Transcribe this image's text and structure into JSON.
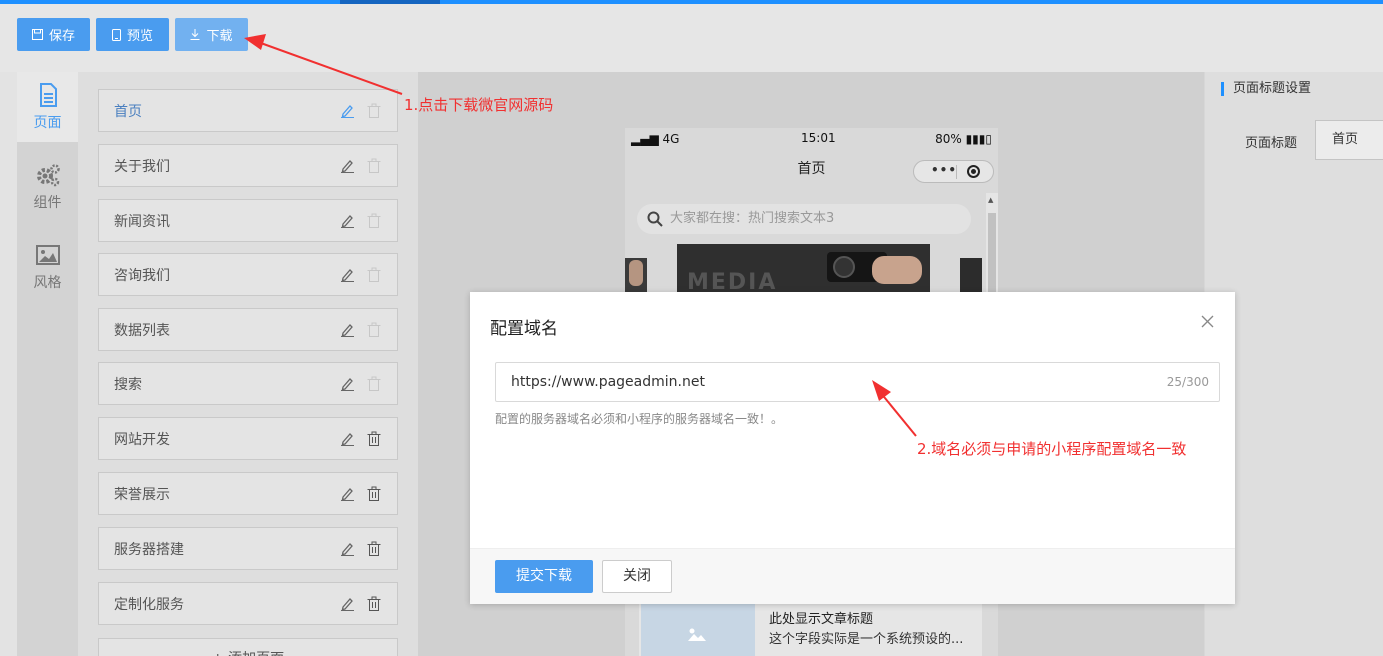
{
  "toolbar": {
    "save_label": "保存",
    "preview_label": "预览",
    "download_label": "下载"
  },
  "nav": {
    "items": [
      {
        "label": "页面",
        "icon": "document-icon"
      },
      {
        "label": "组件",
        "icon": "gears-icon"
      },
      {
        "label": "风格",
        "icon": "image-icon"
      }
    ]
  },
  "pages": {
    "items": [
      {
        "label": "首页"
      },
      {
        "label": "关于我们"
      },
      {
        "label": "新闻资讯"
      },
      {
        "label": "咨询我们"
      },
      {
        "label": "数据列表"
      },
      {
        "label": "搜索"
      },
      {
        "label": "网站开发"
      },
      {
        "label": "荣誉展示"
      },
      {
        "label": "服务器搭建"
      },
      {
        "label": "定制化服务"
      }
    ],
    "add_label": "+ 添加页面"
  },
  "phone": {
    "signal": "4G",
    "time": "15:01",
    "battery": "80%",
    "title": "首页",
    "search_placeholder": "大家都在搜：热门搜索文本3",
    "banner_text": "MEDIA",
    "article_title": "此处显示文章标题",
    "article_desc": "这个字段实际是一个系统预设的..."
  },
  "right_panel": {
    "title": "页面标题设置",
    "label": "页面标题",
    "value": "首页"
  },
  "modal": {
    "title": "配置域名",
    "domain_value": "https://www.pageadmin.net",
    "char_count": "25/300",
    "hint": "配置的服务器域名必须和小程序的服务器域名一致！。",
    "submit_label": "提交下载",
    "close_label": "关闭"
  },
  "annotations": {
    "step1": "1.点击下载微官网源码",
    "step2": "2.域名必须与申请的小程序配置域名一致"
  },
  "colors": {
    "accent": "#4a9cef",
    "annotation": "#f13030",
    "top_bar": "#1e90ff"
  }
}
